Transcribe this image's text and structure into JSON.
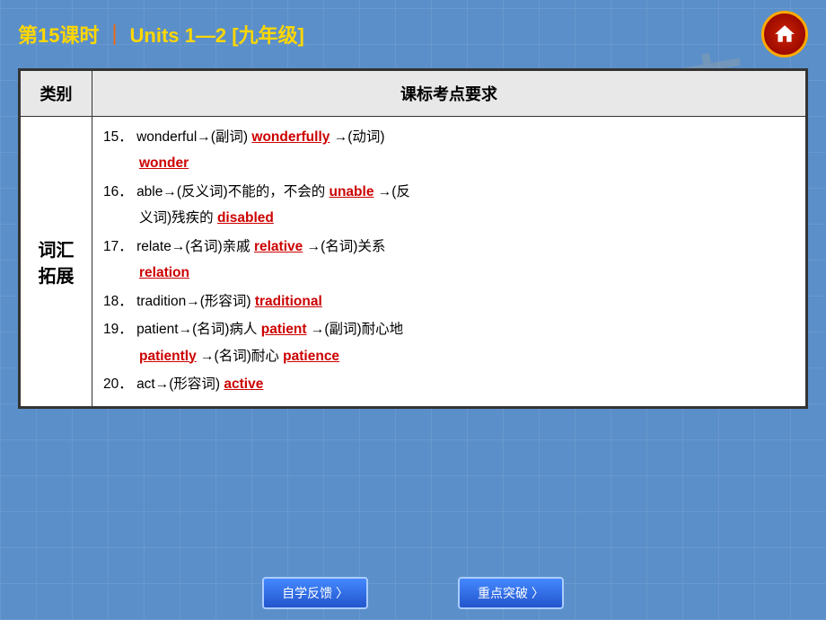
{
  "header": {
    "title_prefix": "第15课时",
    "bar": "｜",
    "title_suffix": "Units 1—2  [九年级]",
    "home_icon": "⌂"
  },
  "watermark": "吉祥",
  "table": {
    "col1_header": "类别",
    "col2_header": "课标考点要求",
    "category": "词汇\n拓展",
    "items": [
      {
        "num": "15．",
        "text1": "wonderful→(副词) ",
        "answer1": "wonderfully",
        "text2": " →(动词)",
        "newline": true,
        "answer2": "wonder",
        "text3": ""
      },
      {
        "num": "16．",
        "text1": "able→(反义词)不能的，不会的 ",
        "answer1": "unable",
        "text2": " →(反义词)残疾的 ",
        "answer2": "disabled"
      },
      {
        "num": "17．",
        "text1": "relate→(名词)亲戚 ",
        "answer1": "relative",
        "text2": " →(名词)关系",
        "newline": true,
        "answer2": "relation"
      },
      {
        "num": "18．",
        "text1": "tradition→(形容词) ",
        "answer1": "traditional"
      },
      {
        "num": "19．",
        "text1": "patient→(名词)病人 ",
        "answer1": "patient",
        "text2": " →(副词)耐心地",
        "newline": true,
        "answer2": "patiently",
        "text3": " →(名词)耐心 ",
        "answer3": "patience"
      },
      {
        "num": "20．",
        "text1": "act→(形容词) ",
        "answer1": "active"
      }
    ]
  },
  "footer": {
    "btn1": "自学反馈 〉",
    "btn2": "重点突破 〉"
  }
}
